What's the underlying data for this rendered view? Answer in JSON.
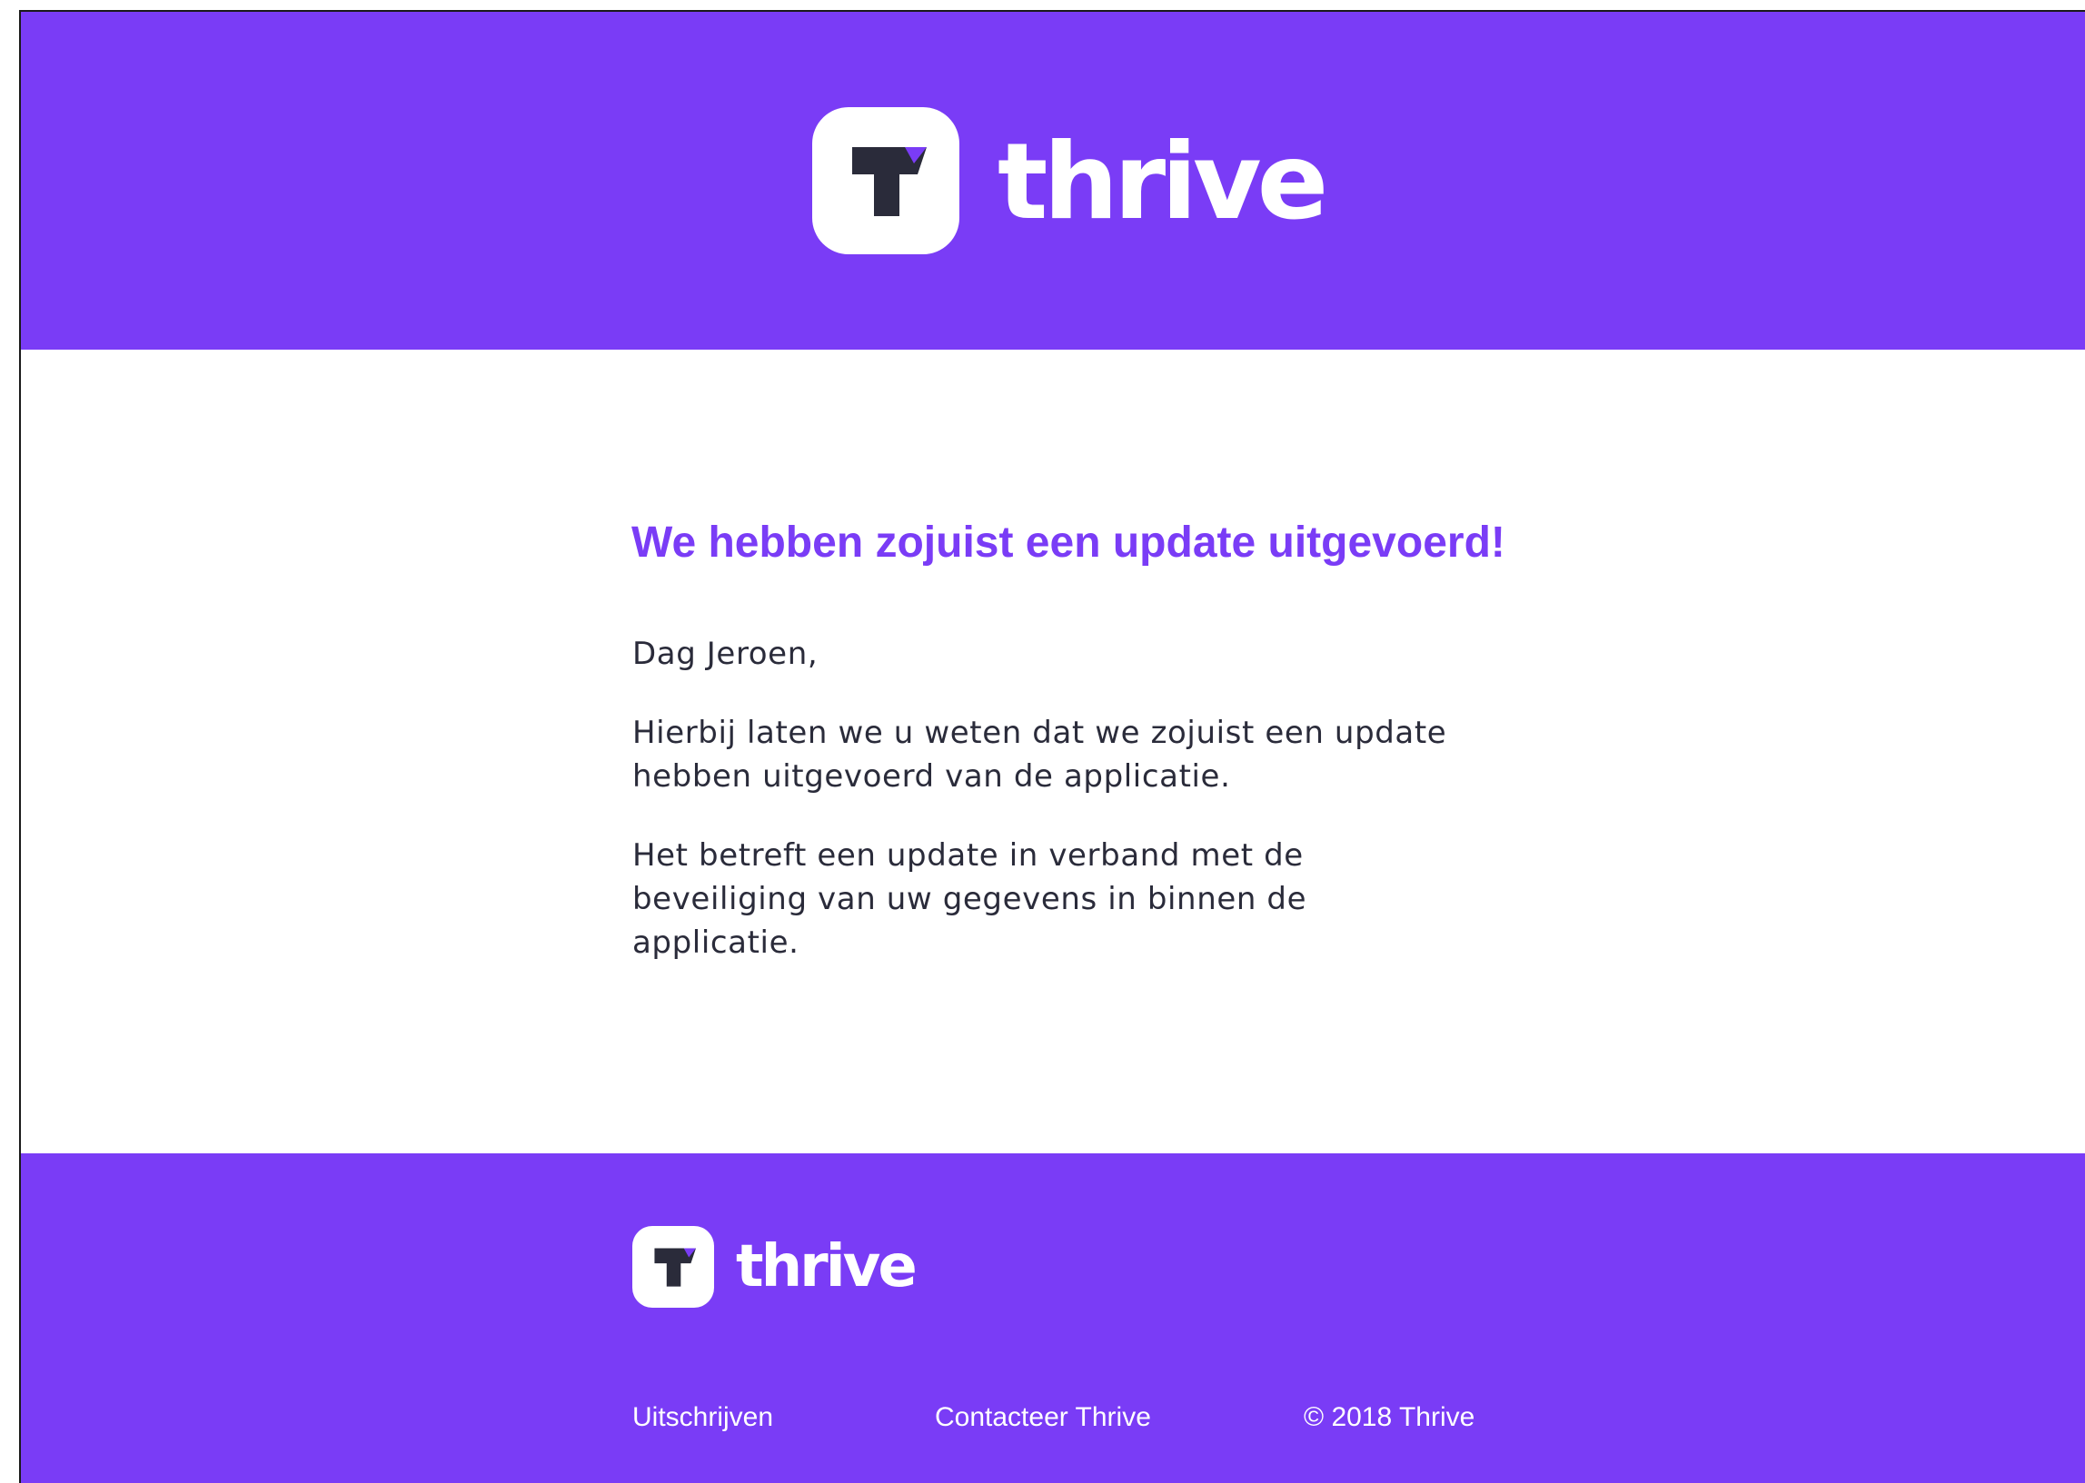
{
  "brand": {
    "name": "thrive",
    "logo_letter": "T",
    "color_primary": "#7a3cf6",
    "color_dark": "#2a2b3a",
    "icon": "thrive-t-logo-icon"
  },
  "email": {
    "title": "We hebben zojuist een update uitgevoerd!",
    "greeting": "Dag Jeroen,",
    "paragraph_1": "Hierbij laten we u weten dat we zojuist een update hebben uitgevoerd van de applicatie.",
    "paragraph_2": "Het betreft een update in verband met de beveiliging van uw gegevens in binnen de applicatie."
  },
  "footer": {
    "brand_name": "thrive",
    "unsubscribe_label": "Uitschrijven",
    "contact_label": "Contacteer Thrive",
    "copyright": "© 2018 Thrive"
  }
}
